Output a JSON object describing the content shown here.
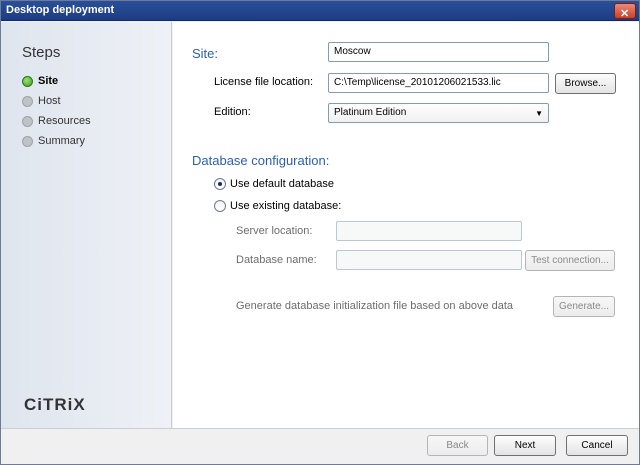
{
  "window": {
    "title": "Desktop deployment"
  },
  "sidebar": {
    "title": "Steps",
    "items": [
      {
        "label": "Site",
        "active": true
      },
      {
        "label": "Host",
        "active": false
      },
      {
        "label": "Resources",
        "active": false
      },
      {
        "label": "Summary",
        "active": false
      }
    ],
    "logo": "CiTRiX"
  },
  "site": {
    "heading": "Site:",
    "name_value": "Moscow",
    "license_label": "License file location:",
    "license_value": "C:\\Temp\\license_20101206021533.lic",
    "browse_label": "Browse...",
    "edition_label": "Edition:",
    "edition_value": "Platinum Edition"
  },
  "database": {
    "heading": "Database configuration:",
    "default_option": "Use default database",
    "existing_option": "Use existing database:",
    "selected": "default",
    "server_label": "Server location:",
    "server_value": "",
    "dbname_label": "Database name:",
    "dbname_value": "",
    "test_label": "Test connection...",
    "generate_text": "Generate database initialization file based on above data",
    "generate_label": "Generate..."
  },
  "footer": {
    "back_label": "Back",
    "next_label": "Next",
    "cancel_label": "Cancel"
  }
}
